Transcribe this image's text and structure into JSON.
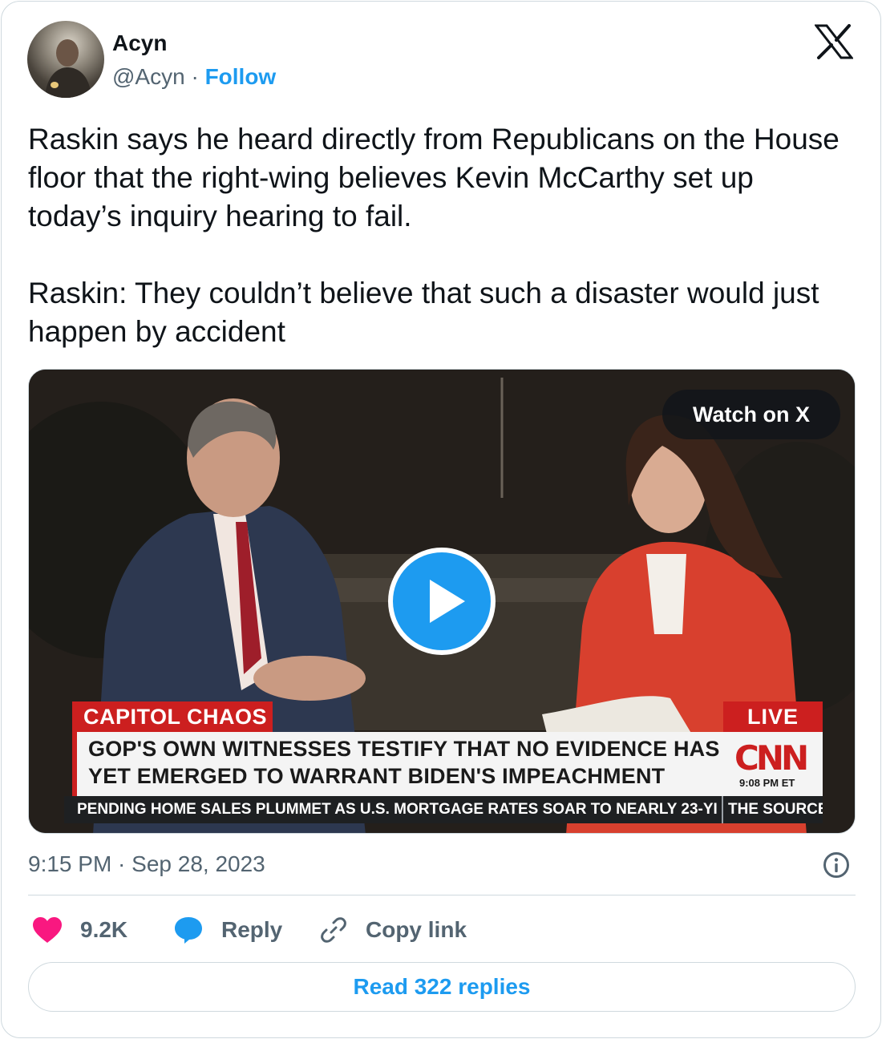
{
  "author": {
    "name": "Acyn",
    "handle": "@Acyn",
    "separator": "·",
    "follow_label": "Follow"
  },
  "tweet": {
    "paragraph_1": "Raskin says he heard directly from Republicans on the House floor that the right-wing believes Kevin McCarthy set up today’s inquiry hearing to fail.",
    "paragraph_2": "Raskin: They couldn’t believe that such a disaster would just happen by accident"
  },
  "media": {
    "watch_label": "Watch on X",
    "chyron_tag": "CAPITOL CHAOS",
    "chyron_live": "LIVE",
    "chyron_line_1": "GOP'S OWN WITNESSES TESTIFY THAT NO EVIDENCE HAS",
    "chyron_line_2": "YET EMERGED TO WARRANT BIDEN'S IMPEACHMENT",
    "network_logo": "CNN",
    "chyron_time": "9:08 PM ET",
    "ticker_text": "PENDING HOME SALES PLUMMET AS U.S. MORTGAGE RATES SOAR TO NEARLY 23-YI",
    "ticker_source": "THE SOURCE"
  },
  "footer": {
    "timestamp": "9:15 PM · Sep 28, 2023",
    "likes": "9.2K",
    "reply_label": "Reply",
    "copy_label": "Copy link",
    "read_replies": "Read 322 replies"
  },
  "colors": {
    "accent": "#1d9bf0",
    "like": "#f91880",
    "cnn_red": "#cc1f1f",
    "muted": "#536471"
  },
  "icons": [
    "x-logo-icon",
    "play-icon",
    "info-icon",
    "heart-icon",
    "reply-bubble-icon",
    "link-icon"
  ]
}
